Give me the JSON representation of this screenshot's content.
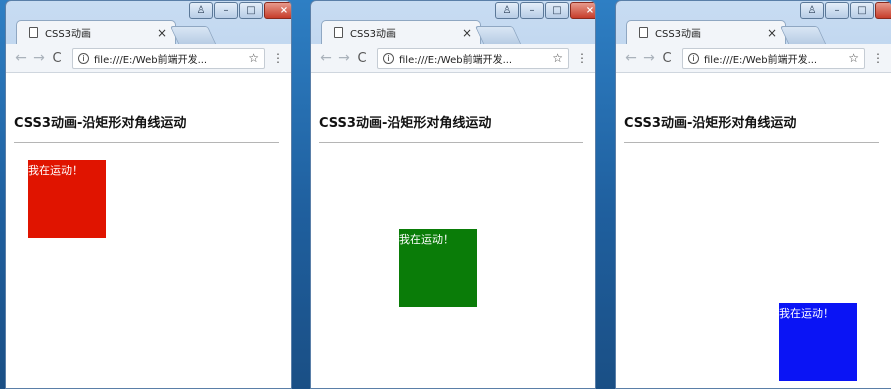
{
  "windows": [
    {
      "tab": {
        "title": "CSS3动画",
        "close": "×"
      },
      "address_bar": {
        "url": "file:///E:/Web前端开发..."
      },
      "page": {
        "heading": "CSS3动画-沿矩形对角线运动",
        "box_text": "我在运动！",
        "box_color": "#e01400"
      }
    },
    {
      "tab": {
        "title": "CSS3动画",
        "close": "×"
      },
      "address_bar": {
        "url": "file:///E:/Web前端开发..."
      },
      "page": {
        "heading": "CSS3动画-沿矩形对角线运动",
        "box_text": "我在运动！",
        "box_color": "#0a7c08"
      }
    },
    {
      "tab": {
        "title": "CSS3动画",
        "close": "×"
      },
      "address_bar": {
        "url": "file:///E:/Web前端开发..."
      },
      "page": {
        "heading": "CSS3动画-沿矩形对角线运动",
        "box_text": "我在运动！",
        "box_color": "#0a14f5"
      }
    }
  ]
}
